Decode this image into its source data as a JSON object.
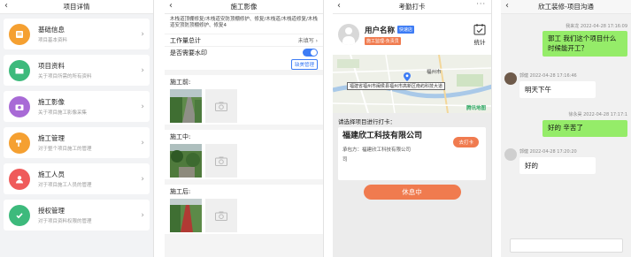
{
  "screen1": {
    "title": "项目详情",
    "items": [
      {
        "title": "基础信息",
        "subtitle": "项目基本资料",
        "icon": "document-icon",
        "color": "#f5a031"
      },
      {
        "title": "项目资料",
        "subtitle": "关于项目所需的所有资料",
        "icon": "folder-icon",
        "color": "#3dba7c"
      },
      {
        "title": "施工影像",
        "subtitle": "关于项目施工影像采集",
        "icon": "camera-icon",
        "color": "#a86ad6"
      },
      {
        "title": "施工管理",
        "subtitle": "对于整个项目施工的管理",
        "icon": "hammer-icon",
        "color": "#f5a031"
      },
      {
        "title": "施工人员",
        "subtitle": "对于项目施工人员的管理",
        "icon": "worker-icon",
        "color": "#ef5b5b"
      },
      {
        "title": "授权管理",
        "subtitle": "对于项目资料权限的管理",
        "icon": "check-shield-icon",
        "color": "#3dba7c"
      }
    ]
  },
  "screen2": {
    "title": "施工影像",
    "address": "木栈道顶棚修复/木栈道安防顶棚修护、修复/木栈道/木栈道修复/木栈道安顶防顶棚修护、修复4",
    "area_label": "工作量总计",
    "area_value": "未填写 ›",
    "watermark_label": "是否需要水印",
    "watermark_button": "缺美管理",
    "phases": [
      {
        "label": "施工前:"
      },
      {
        "label": "施工中:"
      },
      {
        "label": "施工后:"
      }
    ]
  },
  "screen3": {
    "title": "考勤打卡",
    "user_name": "用户名称",
    "user_tag": "快速店",
    "user_tag2": "施工监理-负责员",
    "stats_label": "统计",
    "map_address": "福建省福州市闽侯县福州市高新区南屿科技大道",
    "map_city": "福州市",
    "map_logo": "腾讯地图",
    "select_label": "请选择项目进行打卡：",
    "project_name": "福建欣工科技有限公司",
    "clock_button": "去打卡",
    "contractor": "承包方：福建欣工科技有限公司",
    "contractor2": "司",
    "rest_button": "休息中"
  },
  "screen4": {
    "title": "欣工装修-项目沟通",
    "messages": [
      {
        "side": "right",
        "name": "我来龙",
        "time": "2022-04-28 17:16:09",
        "text": "郭工 我们这个项目什么时候能开工？"
      },
      {
        "side": "left",
        "name": "郭健",
        "time": "2022-04-28 17:16:46",
        "text": "明天下午"
      },
      {
        "side": "right",
        "name": "徐永昊",
        "time": "2022-04-28 17:17:1",
        "text": "好的 辛苦了"
      },
      {
        "side": "left",
        "name": "郭健",
        "time": "2022-04-28 17:20:20",
        "text": "好的"
      }
    ]
  }
}
